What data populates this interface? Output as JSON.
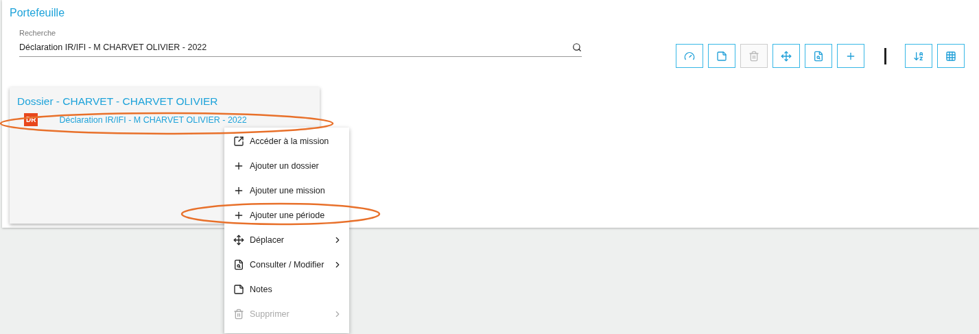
{
  "title": "Portefeuille",
  "search": {
    "label": "Recherche",
    "value": "Déclaration IR/IFI - M CHARVET OLIVIER - 2022"
  },
  "toolbar": [
    {
      "kind": "gauge",
      "disabled": false
    },
    {
      "kind": "note",
      "disabled": false
    },
    {
      "kind": "trash",
      "disabled": true
    },
    {
      "kind": "move",
      "disabled": false
    },
    {
      "kind": "file-search",
      "disabled": false
    },
    {
      "kind": "plus",
      "disabled": false
    },
    {
      "kind": "separator"
    },
    {
      "kind": "sort",
      "disabled": false
    },
    {
      "kind": "grid",
      "disabled": false
    }
  ],
  "card": {
    "title": "Dossier - CHARVET - CHARVET OLIVIER",
    "items": [
      {
        "badge": "DR",
        "label": "Déclaration IR/IFI - M CHARVET OLIVIER - 2022"
      }
    ]
  },
  "context_menu": [
    {
      "kind": "open",
      "label": "Accéder à la mission",
      "submenu": false,
      "disabled": false
    },
    {
      "kind": "plus",
      "label": "Ajouter un dossier",
      "submenu": false,
      "disabled": false
    },
    {
      "kind": "plus",
      "label": "Ajouter une mission",
      "submenu": false,
      "disabled": false
    },
    {
      "kind": "plus",
      "label": "Ajouter une période",
      "submenu": false,
      "disabled": false
    },
    {
      "kind": "move",
      "label": "Déplacer",
      "submenu": true,
      "disabled": false
    },
    {
      "kind": "file-search",
      "label": "Consulter / Modifier",
      "submenu": true,
      "disabled": false
    },
    {
      "kind": "note",
      "label": "Notes",
      "submenu": false,
      "disabled": false
    },
    {
      "kind": "trash",
      "label": "Supprimer",
      "submenu": true,
      "disabled": true
    }
  ]
}
